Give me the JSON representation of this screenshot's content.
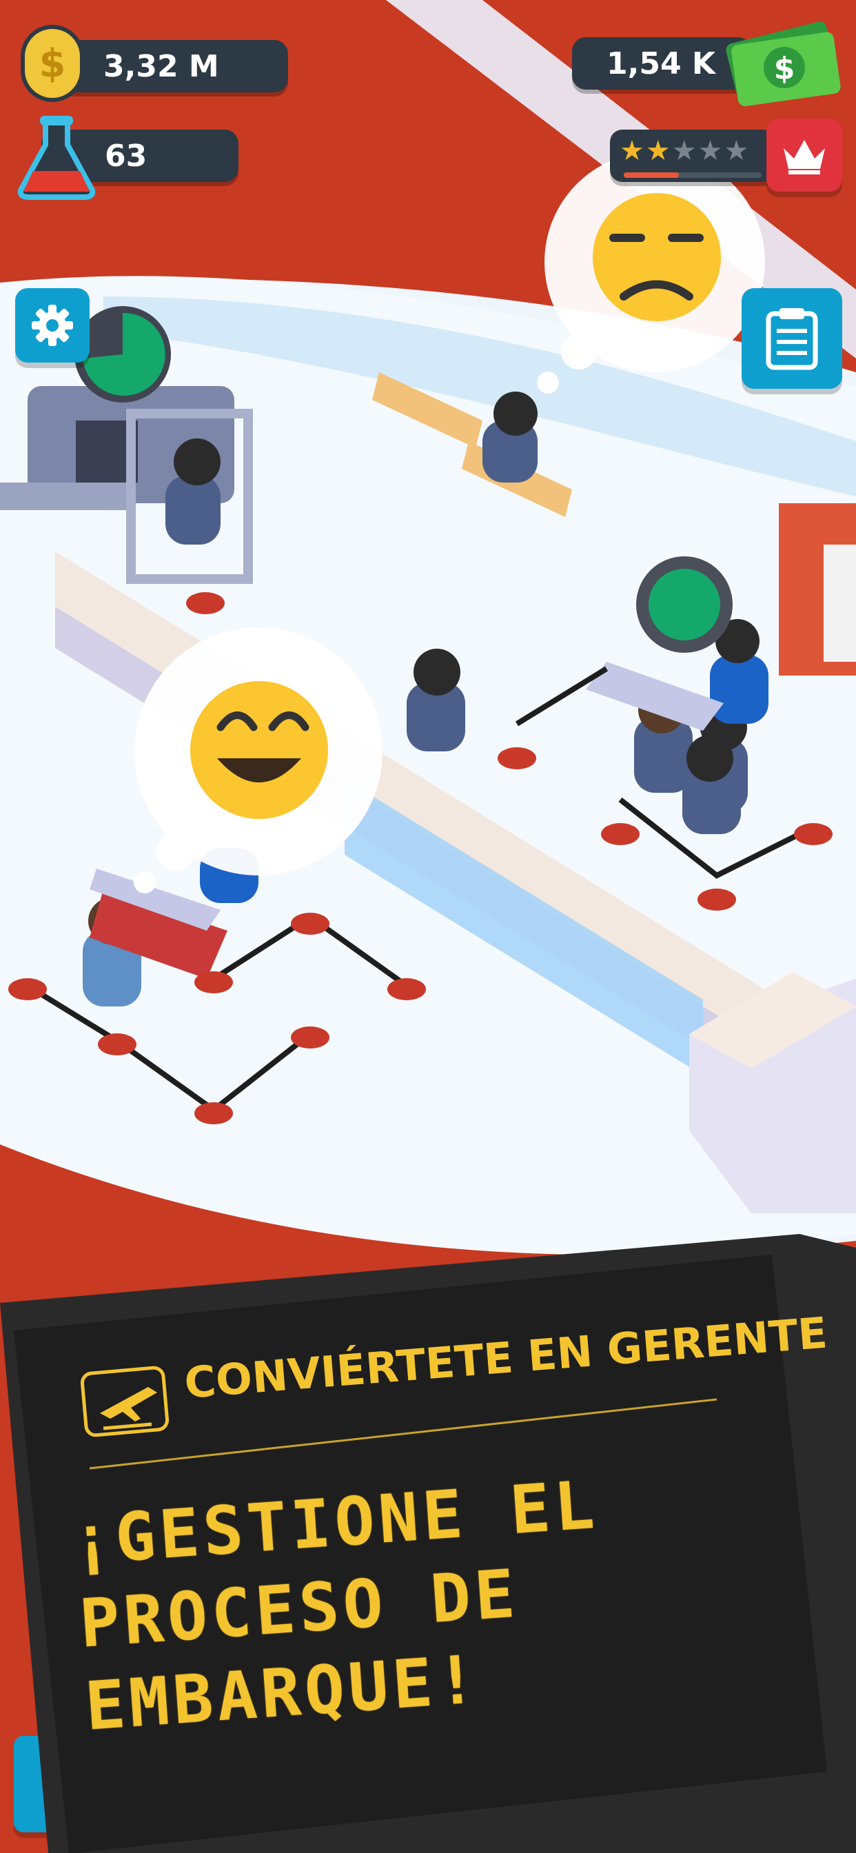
{
  "hud": {
    "coins": "3,32 M",
    "research": "63",
    "cash": "1,54 K",
    "rating_stars": 2,
    "rating_max": 5
  },
  "buttons": {
    "settings_icon": "gear-icon",
    "tasks_icon": "clipboard-icon",
    "vip_icon": "crown-icon"
  },
  "board": {
    "title": "CONVIÉRTETE EN GERENTE",
    "message_lines": [
      "¡GESTIONE EL",
      "PROCESO DE",
      "EMBARQUE!"
    ]
  },
  "colors": {
    "accent_red": "#cc3b22",
    "board_bg": "#232323",
    "board_text": "#f3c430",
    "hud_bg": "#2d3944",
    "teal_button": "#0f9fcf",
    "green_progress": "#14a86b"
  }
}
